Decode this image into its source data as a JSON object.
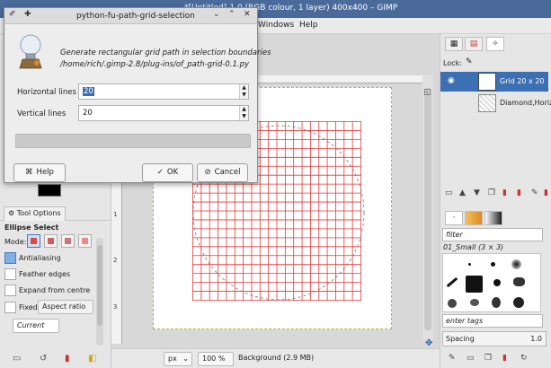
{
  "window": {
    "title": "*[Untitled]-1.0 (RGB colour, 1 layer) 400x400 – GIMP"
  },
  "menubar": {
    "items": [
      "Windows",
      "Help"
    ]
  },
  "dialog": {
    "title": "python-fu-path-grid-selection",
    "description_line1": "Generate rectangular grid path in selection boundaries",
    "description_line2": "/home/rich/.gimp-2.8/plug-ins/of_path-grid-0.1.py",
    "horizontal_label": "Horizontal lines",
    "horizontal_value": "20",
    "vertical_label": "Vertical lines",
    "vertical_value": "20",
    "help_label": "Help",
    "ok_label": "OK",
    "cancel_label": "Cancel"
  },
  "canvas": {
    "grid_rows": 20,
    "grid_cols": 20,
    "grid_color": "#e03a3a",
    "vruler_ticks": [
      "1",
      "2",
      "3"
    ]
  },
  "statusbar": {
    "unit": "px",
    "zoom": "100 %",
    "layer_info": "Background (2.9 MB)"
  },
  "toolbox": {
    "tab_label": "Tool Options",
    "tool_title": "Ellipse Select",
    "mode_label": "Mode:",
    "antialiasing": "Antialiasing",
    "feather_edges": "Feather edges",
    "expand_from_centre": "Expand from centre",
    "fixed_label": "Fixed:",
    "fixed_value": "Aspect ratio",
    "current_value": "Current"
  },
  "layers": {
    "lock_label": "Lock:",
    "items": [
      {
        "name": "Grid 20 x 20",
        "selected": true
      },
      {
        "name": "Diamond,Horizor",
        "selected": false
      }
    ]
  },
  "brushes": {
    "filter_placeholder": "filter",
    "brush_name": "01_Small (3 × 3)",
    "tags_placeholder": "enter tags",
    "spacing_label": "Spacing",
    "spacing_value": "1.0"
  }
}
